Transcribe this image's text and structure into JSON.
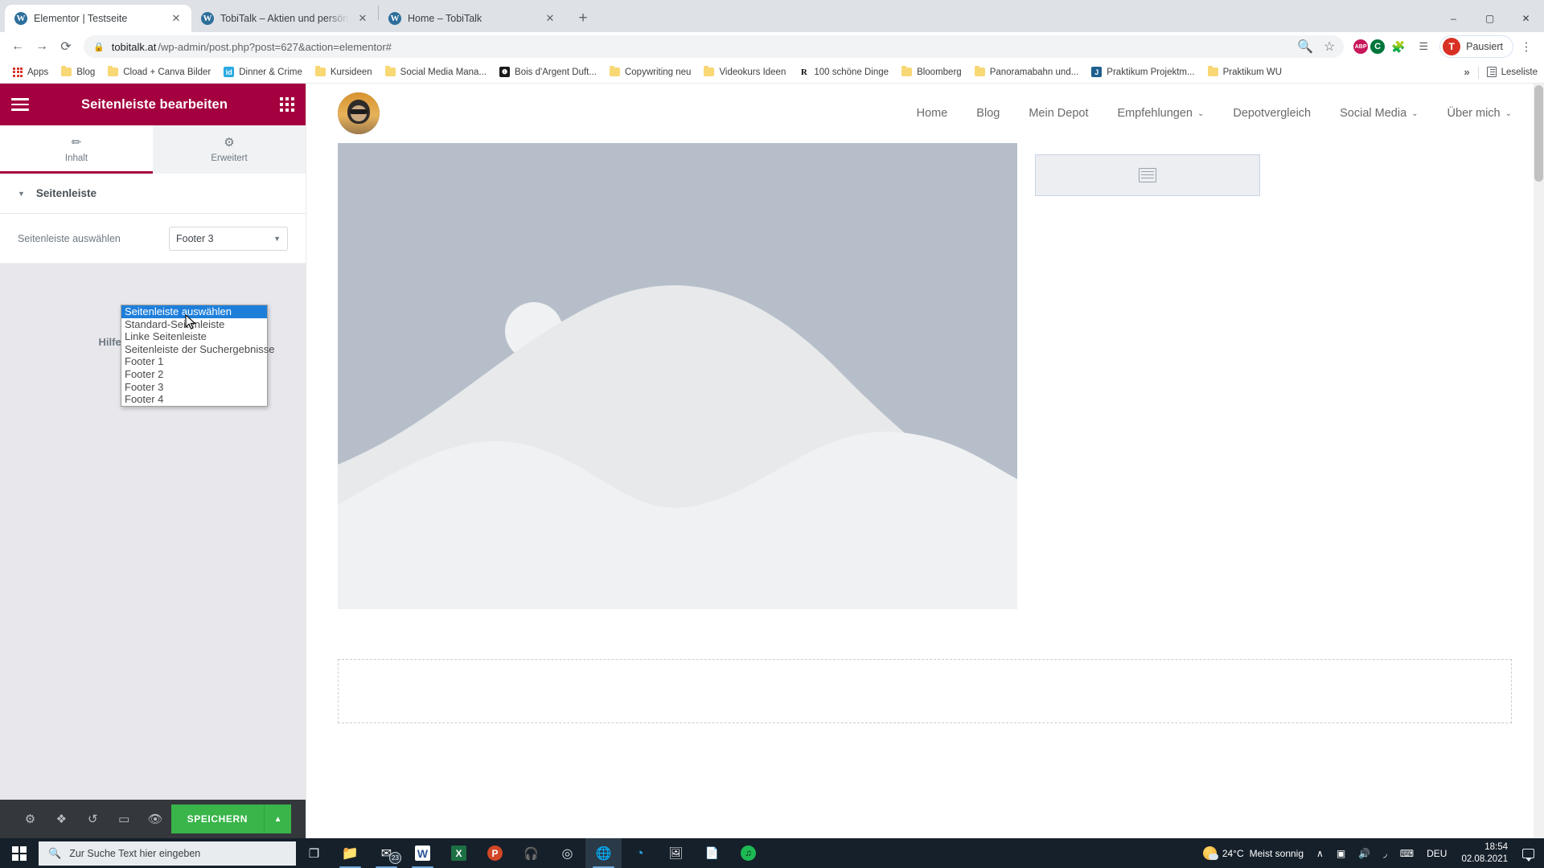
{
  "browser": {
    "tabs": [
      {
        "title": "Elementor | Testseite",
        "favicon": "wordpress-icon",
        "active": true,
        "closable": true
      },
      {
        "title": "TobiTalk – Aktien und persönliche",
        "favicon": "wordpress-icon",
        "active": false,
        "closable": true
      },
      {
        "title": "Home – TobiTalk",
        "favicon": "wordpress-icon",
        "active": false,
        "closable": true
      }
    ],
    "new_tab_label": "+",
    "window_controls": {
      "minimize": "–",
      "maximize": "▢",
      "close": "✕"
    },
    "nav": {
      "back": "←",
      "forward": "→",
      "reload": "⟳"
    },
    "omnibox": {
      "lock_icon": "lock-icon",
      "url_domain": "tobitalk.at",
      "url_path": "/wp-admin/post.php?post=627&action=elementor#",
      "zoom_icon": "zoom-icon",
      "bookmark_icon": "star-icon"
    },
    "extensions": [
      {
        "name": "adblock-plus-icon",
        "label": "ABP",
        "color": "#c8175a"
      },
      {
        "name": "ghostery-icon",
        "label": "C",
        "color": "#00753a"
      },
      {
        "name": "puzzle-extensions-icon",
        "label": "",
        "color": "#5f6368"
      },
      {
        "name": "media-playlist-icon",
        "label": "",
        "color": "#5f6368"
      }
    ],
    "profile": {
      "initial": "T",
      "label": "Pausiert",
      "color": "#d93025"
    },
    "menu_icon": "three-dot-menu-icon",
    "bookmarks": [
      {
        "label": "Apps",
        "icon": "apps-grid-icon"
      },
      {
        "label": "Blog",
        "icon": "folder-icon"
      },
      {
        "label": "Cload + Canva Bilder",
        "icon": "folder-icon"
      },
      {
        "label": "Dinner & Crime",
        "icon": "id-site-icon",
        "color": "#29a9e1",
        "glyph": "id"
      },
      {
        "label": "Kursideen",
        "icon": "folder-icon"
      },
      {
        "label": "Social Media Mana...",
        "icon": "folder-icon"
      },
      {
        "label": "Bois d'Argent Duft...",
        "icon": "dark-site-icon",
        "color": "#1a1a1a",
        "glyph": "❶"
      },
      {
        "label": "Copywriting neu",
        "icon": "folder-icon"
      },
      {
        "label": "Videokurs Ideen",
        "icon": "folder-icon"
      },
      {
        "label": "100 schöne Dinge",
        "icon": "r-site-icon",
        "color": "#ffffff",
        "glyph": "R"
      },
      {
        "label": "Bloomberg",
        "icon": "folder-icon"
      },
      {
        "label": "Panoramabahn und...",
        "icon": "folder-icon"
      },
      {
        "label": "Praktikum Projektm...",
        "icon": "j-site-icon",
        "color": "#1e5f8e",
        "glyph": "J"
      },
      {
        "label": "Praktikum WU",
        "icon": "folder-icon"
      }
    ],
    "bookmarks_overflow": "»",
    "reading_list_label": "Leseliste"
  },
  "elementor": {
    "header": {
      "title": "Seitenleiste bearbeiten",
      "menu_icon": "hamburger-icon",
      "apps_icon": "apps-grid-icon",
      "accent": "#a4003f"
    },
    "tabs": [
      {
        "label": "Inhalt",
        "icon": "pencil-icon",
        "active": true
      },
      {
        "label": "Erweitert",
        "icon": "gear-icon",
        "active": false
      }
    ],
    "section": {
      "title": "Seitenleiste",
      "caret": "▼"
    },
    "control": {
      "label": "Seitenleiste auswählen",
      "selected_value": "Footer 3",
      "caret": "▼"
    },
    "dropdown": {
      "open": true,
      "options": [
        "Seitenleiste auswählen",
        "Standard-Seitenleiste",
        "Linke Seitenleiste",
        "Seitenleiste der Suchergebnisse",
        "Footer 1",
        "Footer 2",
        "Footer 3",
        "Footer 4"
      ],
      "highlighted_index": 0,
      "highlight_color": "#1e7fdb"
    },
    "help_text": "Hilfe ben",
    "footer": {
      "icons": [
        {
          "name": "settings-gear-icon",
          "glyph": "⚙"
        },
        {
          "name": "navigator-layers-icon",
          "glyph": "❖"
        },
        {
          "name": "history-icon",
          "glyph": "↺"
        },
        {
          "name": "responsive-mode-icon",
          "glyph": "▭"
        },
        {
          "name": "preview-eye-icon",
          "glyph": "👁"
        }
      ],
      "save_label": "SPEICHERN",
      "save_caret": "▲",
      "save_color": "#39b54a"
    }
  },
  "preview": {
    "nav_items": [
      {
        "label": "Home",
        "has_caret": false
      },
      {
        "label": "Blog",
        "has_caret": false
      },
      {
        "label": "Mein Depot",
        "has_caret": false
      },
      {
        "label": "Empfehlungen",
        "has_caret": true
      },
      {
        "label": "Depotvergleich",
        "has_caret": false
      },
      {
        "label": "Social Media",
        "has_caret": true
      },
      {
        "label": "Über mich",
        "has_caret": true
      }
    ],
    "caret_glyph": "⌄",
    "logo_name": "site-avatar-logo",
    "hero_placeholder": "image-placeholder",
    "sidebar_widget_placeholder": "widget-placeholder-icon",
    "collapse_handle": "‹"
  },
  "taskbar": {
    "start_icon": "windows-start-icon",
    "search_placeholder": "Zur Suche Text hier eingeben",
    "search_icon": "search-icon",
    "apps": [
      {
        "name": "task-view-icon",
        "glyph": "❐"
      },
      {
        "name": "file-explorer-icon",
        "glyph": "📁"
      },
      {
        "name": "mail-icon",
        "glyph": "✉",
        "badge": "23"
      },
      {
        "name": "word-icon",
        "glyph": "W"
      },
      {
        "name": "excel-icon",
        "glyph": "X"
      },
      {
        "name": "powerpoint-icon",
        "glyph": "P"
      },
      {
        "name": "headphones-icon",
        "glyph": "♪"
      },
      {
        "name": "obs-studio-icon",
        "glyph": "◎"
      },
      {
        "name": "chrome-icon",
        "glyph": "◉"
      },
      {
        "name": "edge-icon",
        "glyph": "◔"
      },
      {
        "name": "photo-editor-icon",
        "glyph": "🖼"
      },
      {
        "name": "acrobat-icon",
        "glyph": "A"
      },
      {
        "name": "spotify-icon",
        "glyph": "♫"
      }
    ],
    "weather": {
      "temperature": "24°C",
      "condition": "Meist sonnig",
      "icon": "sun-cloud-icon"
    },
    "tray": [
      {
        "name": "show-hidden-icons-chevron",
        "glyph": "∧"
      },
      {
        "name": "webcam-icon",
        "glyph": "▣"
      },
      {
        "name": "volume-icon",
        "glyph": "🔊"
      },
      {
        "name": "wifi-icon",
        "glyph": "◞"
      },
      {
        "name": "keyboard-icon",
        "glyph": "⌨"
      }
    ],
    "language": "DEU",
    "time": "18:54",
    "date": "02.08.2021",
    "notifications_icon": "notification-center-icon"
  }
}
